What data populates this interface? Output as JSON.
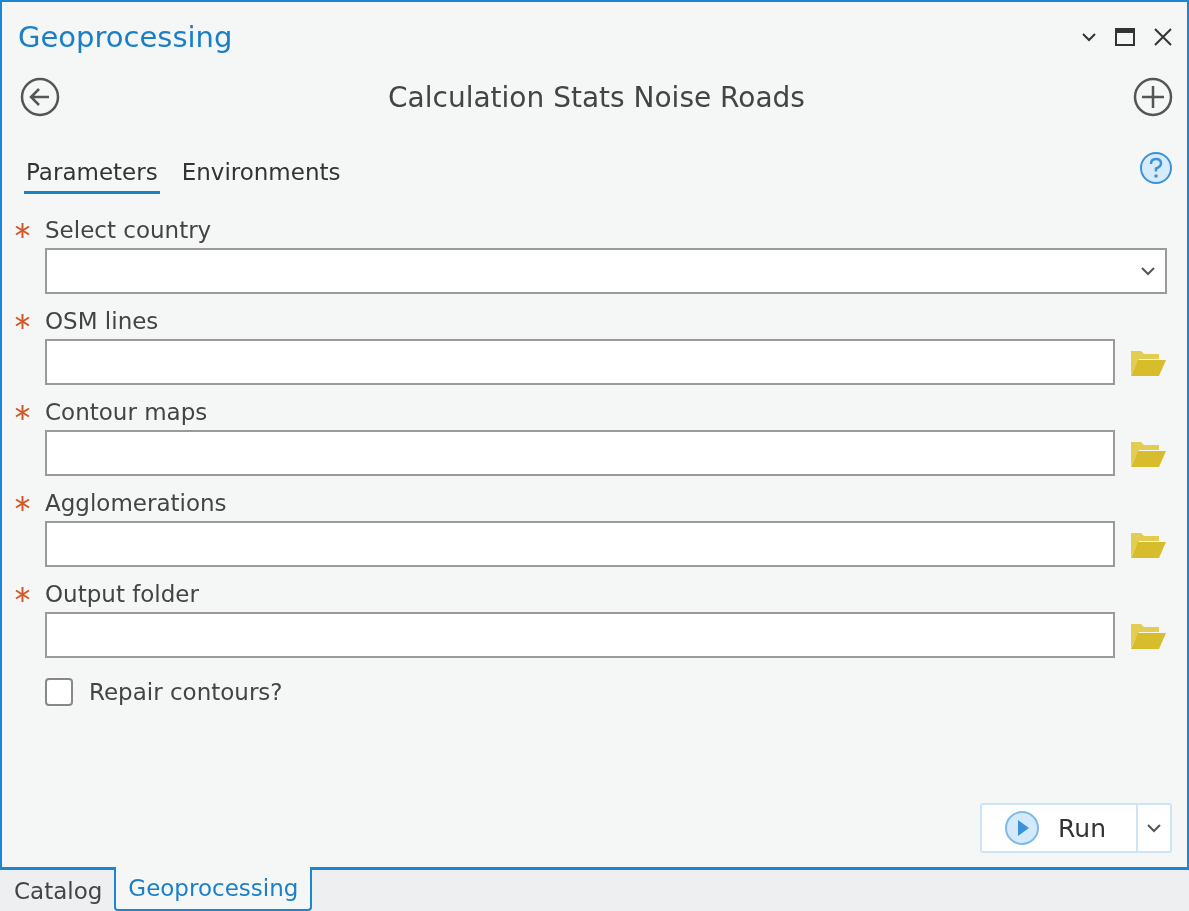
{
  "window": {
    "title": "Geoprocessing"
  },
  "tool": {
    "title": "Calculation Stats Noise Roads"
  },
  "tabs": [
    {
      "label": "Parameters",
      "selected": true
    },
    {
      "label": "Environments",
      "selected": false
    }
  ],
  "parameters": [
    {
      "kind": "dropdown",
      "label": "Select country",
      "required": true
    },
    {
      "kind": "file",
      "label": "OSM lines",
      "required": true
    },
    {
      "kind": "file",
      "label": "Contour maps",
      "required": true
    },
    {
      "kind": "file",
      "label": "Agglomerations",
      "required": true
    },
    {
      "kind": "file",
      "label": "Output folder",
      "required": true
    }
  ],
  "checkbox": {
    "label": "Repair contours?",
    "checked": false
  },
  "run_button": {
    "label": "Run"
  },
  "dock_tabs": [
    {
      "label": "Catalog",
      "selected": false
    },
    {
      "label": "Geoprocessing",
      "selected": true
    }
  ]
}
